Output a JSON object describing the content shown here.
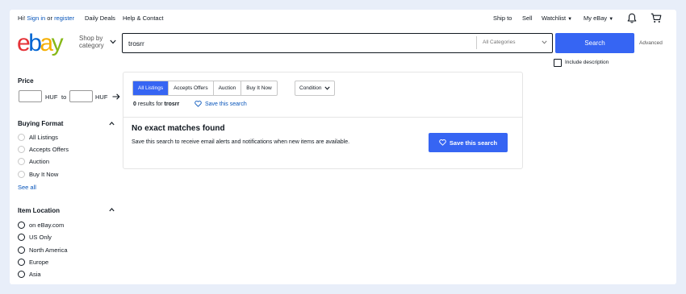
{
  "topbar": {
    "greeting": "Hi!",
    "sign_in": "Sign in",
    "or": "or",
    "register": "register",
    "daily_deals": "Daily Deals",
    "help": "Help & Contact",
    "ship_to": "Ship to",
    "sell": "Sell",
    "watchlist": "Watchlist",
    "my_ebay": "My eBay",
    "icons": [
      "bell-icon",
      "cart-icon"
    ]
  },
  "header": {
    "logo": [
      "e",
      "b",
      "a",
      "y"
    ],
    "shop_by_line1": "Shop by",
    "shop_by_line2": "category",
    "search_value": "trosrr",
    "category_select": "All Categories",
    "search_button": "Search",
    "advanced": "Advanced",
    "include_description": "Include description"
  },
  "sidebar": {
    "price": {
      "heading": "Price",
      "currency_min": "HUF",
      "to": "to",
      "currency_max": "HUF"
    },
    "buying_format": {
      "heading": "Buying Format",
      "options": [
        "All Listings",
        "Accepts Offers",
        "Auction",
        "Buy It Now"
      ],
      "see_all": "See all"
    },
    "item_location": {
      "heading": "Item Location",
      "options": [
        "on eBay.com",
        "US Only",
        "North America",
        "Europe",
        "Asia"
      ]
    }
  },
  "results": {
    "tabs": [
      "All Listings",
      "Accepts Offers",
      "Auction",
      "Buy It Now"
    ],
    "condition": "Condition",
    "count": "0",
    "results_for": "results for",
    "query": "trosrr",
    "save_search_link": "Save this search",
    "no_match_title": "No exact matches found",
    "no_match_desc": "Save this search to receive email alerts and notifications when new items are available.",
    "save_search_button": "Save this search"
  },
  "colors": {
    "accent": "#3665f3",
    "link": "#0654ba",
    "logo_e": "#e53238",
    "logo_b": "#0064d2",
    "logo_a": "#f5af02",
    "logo_y": "#86b817",
    "background": "#e8eef9"
  }
}
